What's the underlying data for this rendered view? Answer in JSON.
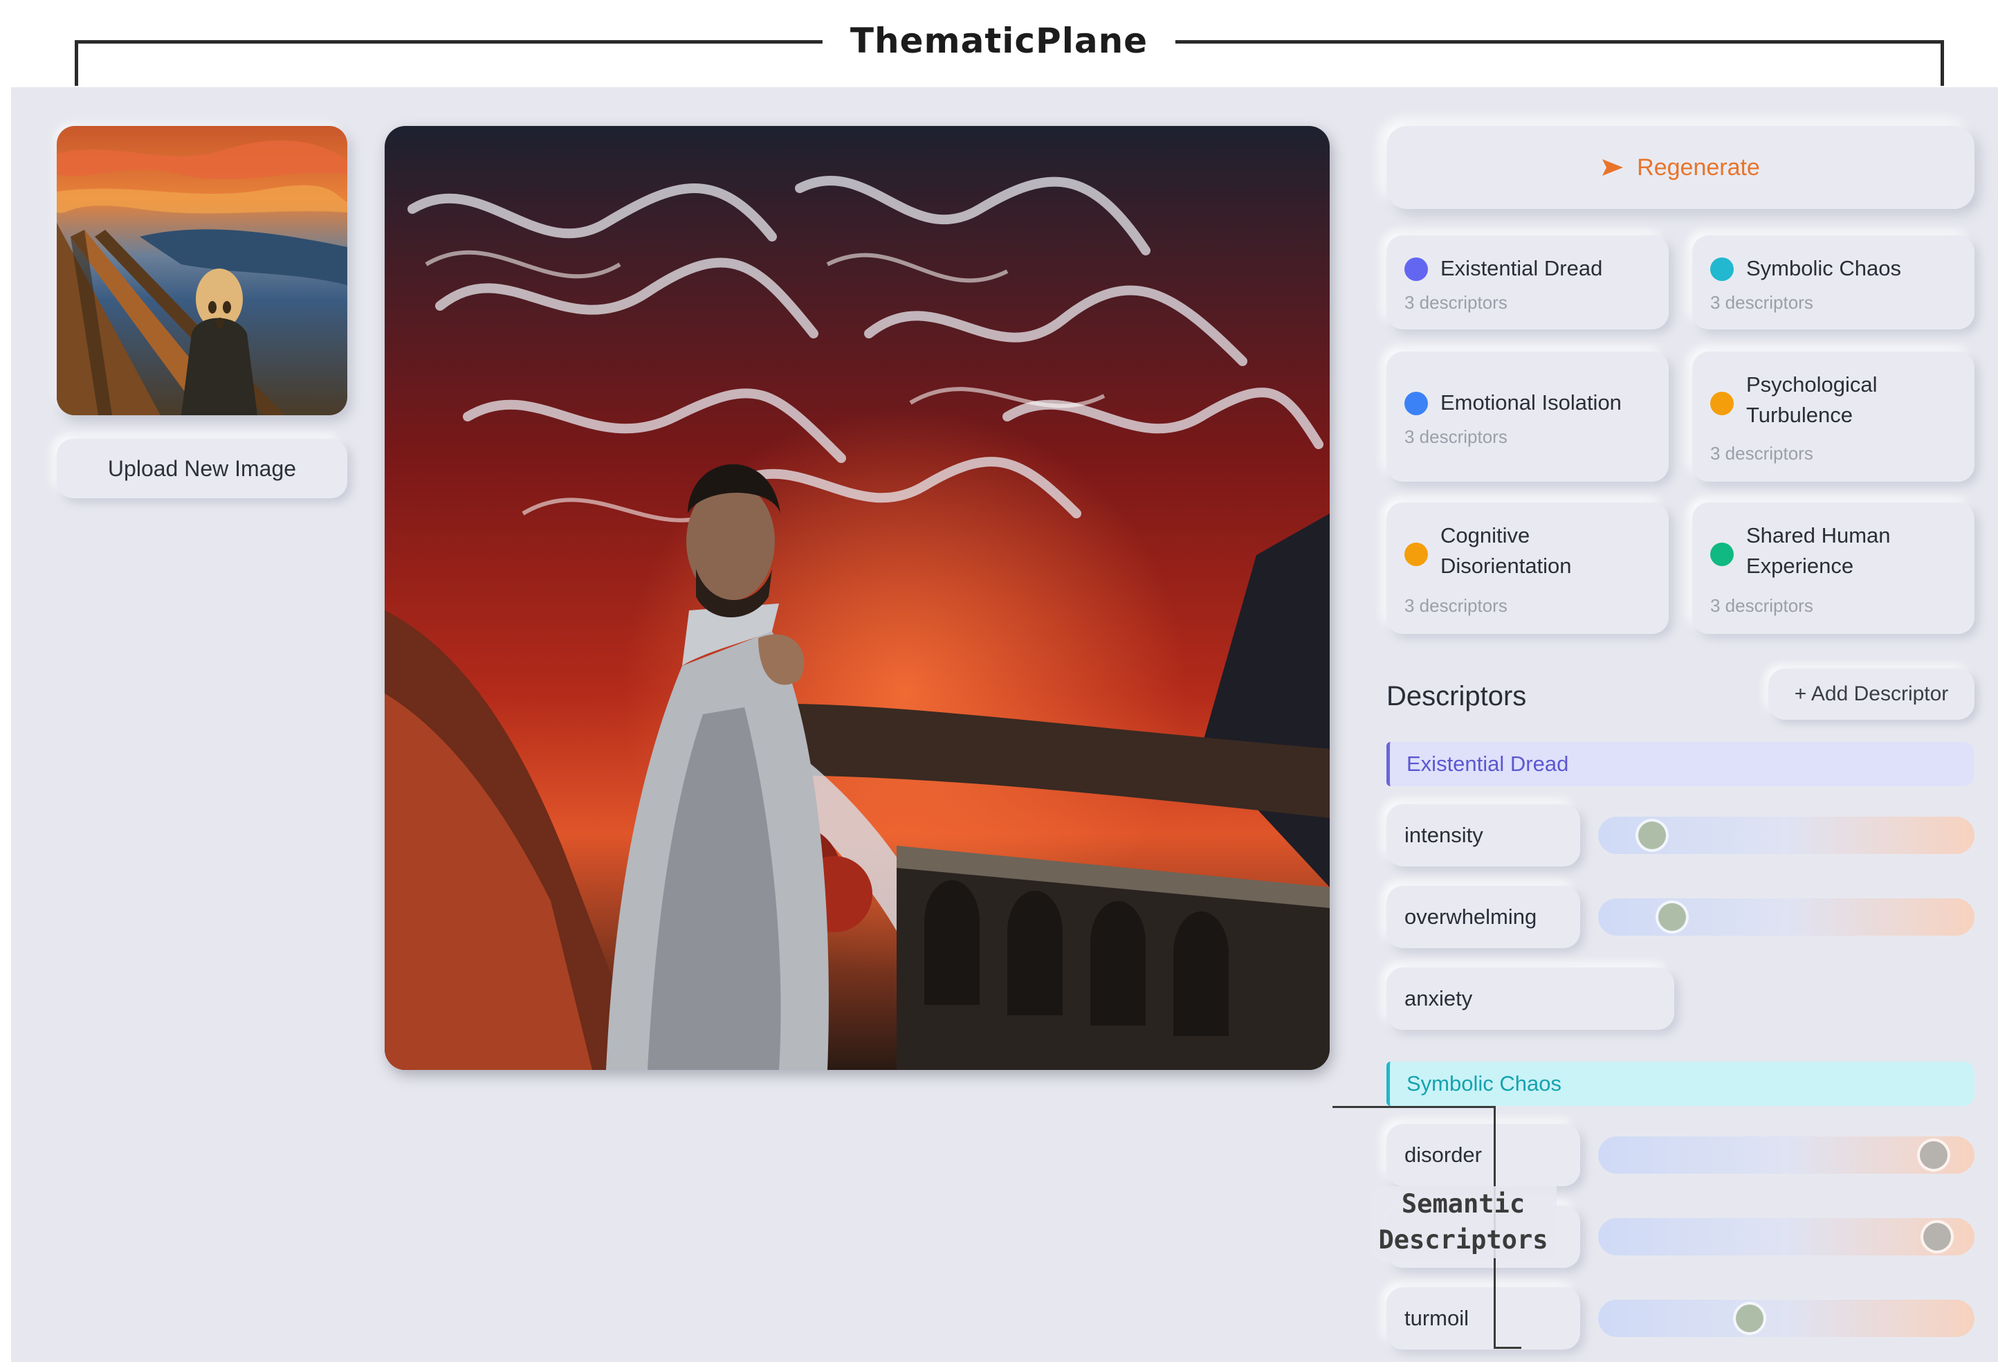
{
  "header": {
    "title": "ThematicPlane"
  },
  "left": {
    "upload_label": "Upload New Image"
  },
  "right": {
    "regenerate_label": "Regenerate",
    "accent": "#e8742a",
    "themes": [
      {
        "name": "Existential Dread",
        "count": "3 descriptors",
        "color": "#6366f1"
      },
      {
        "name": "Symbolic Chaos",
        "count": "3 descriptors",
        "color": "#22b8cf"
      },
      {
        "name": "Emotional Isolation",
        "count": "3 descriptors",
        "color": "#3b82f6"
      },
      {
        "name": "Psychological Turbulence",
        "count": "3 descriptors",
        "color": "#f59e0b"
      },
      {
        "name": "Cognitive Disorientation",
        "count": "3 descriptors",
        "color": "#f59e0b"
      },
      {
        "name": "Shared Human Experience",
        "count": "3 descriptors",
        "color": "#10b981"
      }
    ],
    "descriptors_title": "Descriptors",
    "add_descriptor_label": "+ Add Descriptor",
    "groups": [
      {
        "name": "Existential Dread",
        "items": [
          {
            "label": "intensity",
            "slider_value": 0.1
          },
          {
            "label": "overwhelming",
            "slider_value": 0.16
          },
          {
            "label": "anxiety"
          }
        ]
      },
      {
        "name": "Symbolic Chaos",
        "items": [
          {
            "label": "disorder",
            "slider_value": 0.94
          },
          {
            "label": "",
            "slider_value": 0.95
          },
          {
            "label": "turmoil",
            "slider_value": 0.39
          }
        ]
      }
    ]
  },
  "annotation": {
    "line1": "Semantic",
    "line2": "Descriptors"
  }
}
